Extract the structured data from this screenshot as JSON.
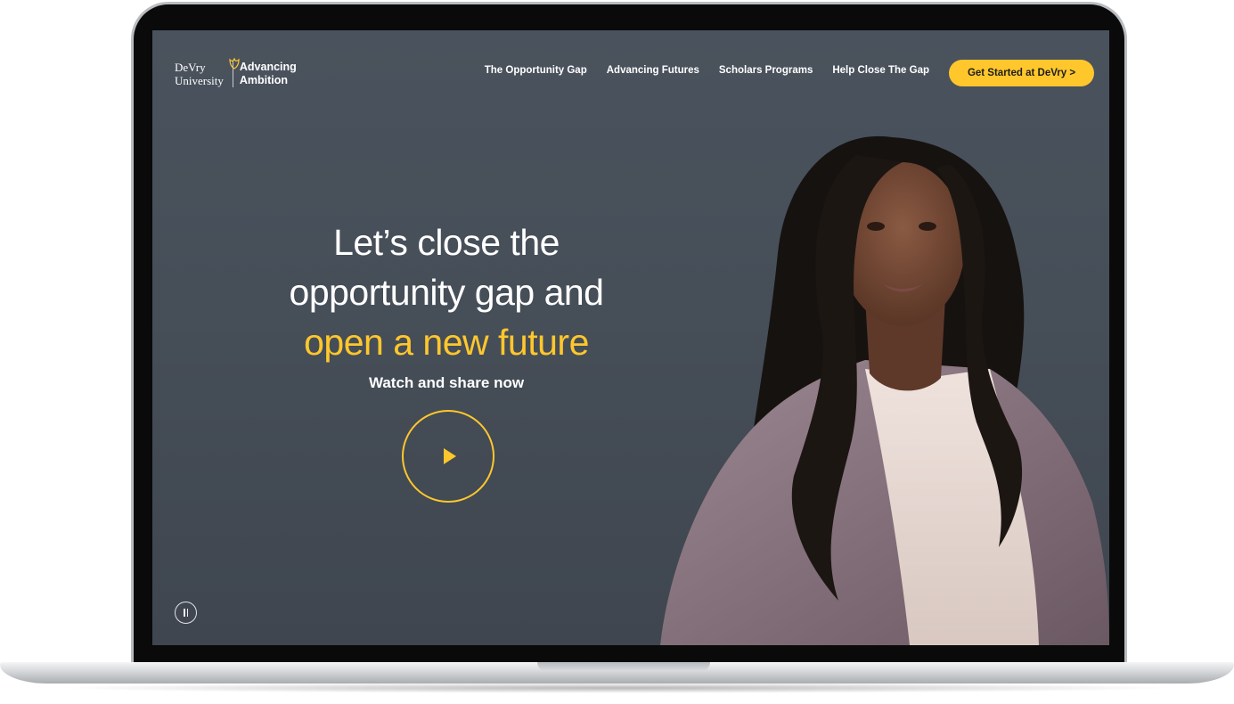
{
  "logo": {
    "brand_line1": "DeVry",
    "brand_line2": "University",
    "tagline_line1": "Advancing",
    "tagline_line2": "Ambition"
  },
  "nav": {
    "items": [
      {
        "label": "The Opportunity Gap"
      },
      {
        "label": "Advancing Futures"
      },
      {
        "label": "Scholars Programs"
      },
      {
        "label": "Help Close The Gap"
      }
    ],
    "cta_label": "Get Started at DeVry >"
  },
  "hero": {
    "line1": "Let’s close the",
    "line2": "opportunity gap and",
    "line3": "open a new future",
    "subtitle": "Watch and share now"
  },
  "colors": {
    "accent": "#ffc72c",
    "background": "#474f59",
    "text": "#ffffff"
  },
  "icons": {
    "play": "play-icon",
    "pause": "pause-icon",
    "logo_mark": "tulip-logo-icon"
  }
}
